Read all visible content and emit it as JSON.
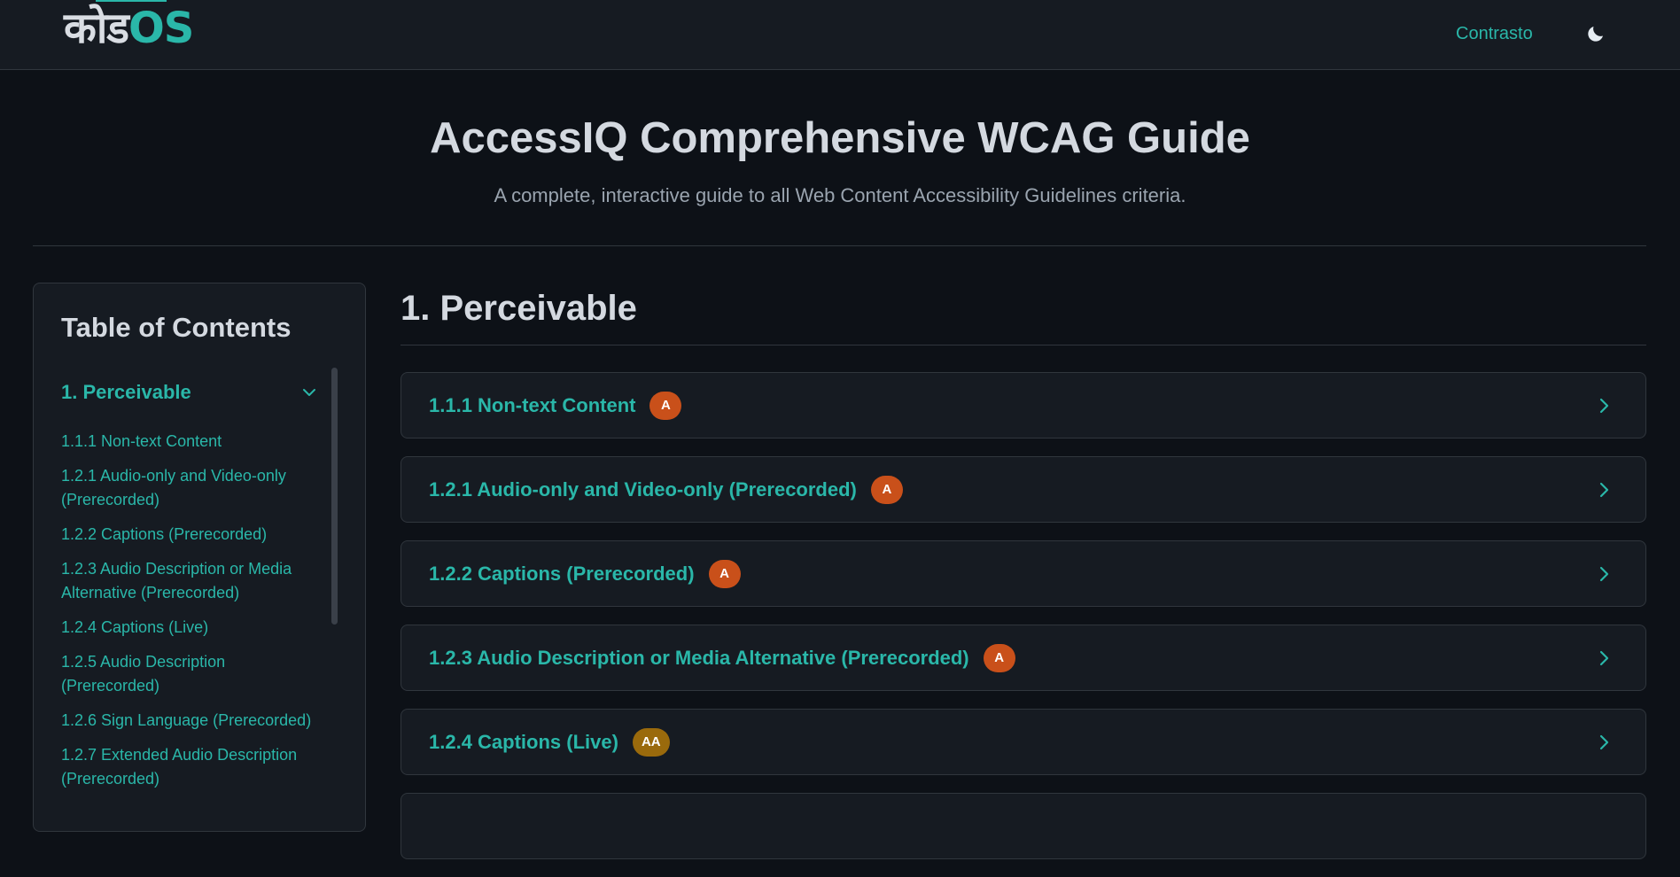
{
  "header": {
    "logo_part1": "कोड",
    "logo_part2": "OS",
    "contrast_label": "Contrasto",
    "theme_icon": "moon-icon"
  },
  "hero": {
    "title": "AccessIQ Comprehensive WCAG Guide",
    "subtitle": "A complete, interactive guide to all Web Content Accessibility Guidelines criteria."
  },
  "toc": {
    "title": "Table of Contents",
    "section_label": "1. Perceivable",
    "section_icon": "chevron-down-icon",
    "items": [
      "1.1.1 Non-text Content",
      "1.2.1 Audio-only and Video-only (Prerecorded)",
      "1.2.2 Captions (Prerecorded)",
      "1.2.3 Audio Description or Media Alternative (Prerecorded)",
      "1.2.4 Captions (Live)",
      "1.2.5 Audio Description (Prerecorded)",
      "1.2.6 Sign Language (Prerecorded)",
      "1.2.7 Extended Audio Description (Prerecorded)"
    ]
  },
  "main": {
    "title": "1. Perceivable",
    "criteria": [
      {
        "title": "1.1.1 Non-text Content",
        "level": "A",
        "color": "#c9501a"
      },
      {
        "title": "1.2.1 Audio-only and Video-only (Prerecorded)",
        "level": "A",
        "color": "#c9501a"
      },
      {
        "title": "1.2.2 Captions (Prerecorded)",
        "level": "A",
        "color": "#c9501a"
      },
      {
        "title": "1.2.3 Audio Description or Media Alternative (Prerecorded)",
        "level": "A",
        "color": "#c9501a"
      },
      {
        "title": "1.2.4 Captions (Live)",
        "level": "AA",
        "color": "#9a6a0c"
      }
    ]
  },
  "colors": {
    "accent": "#2ab7a9",
    "background": "#0d1117",
    "panel": "#161b22",
    "level_a": "#c9501a",
    "level_aa": "#9a6a0c"
  }
}
